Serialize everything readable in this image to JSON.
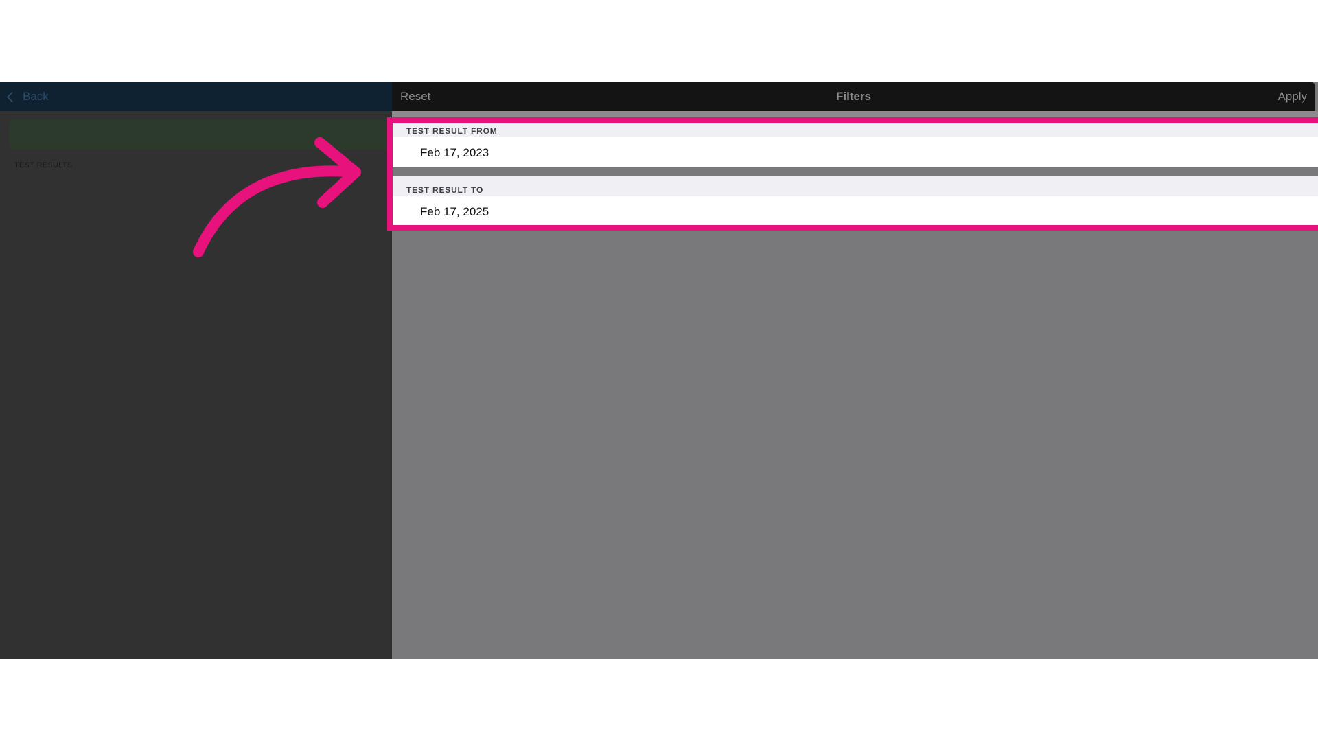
{
  "left_pane": {
    "back_label": "Back",
    "section_label": "TEST RESULTS"
  },
  "filters": {
    "reset_label": "Reset",
    "title": "Filters",
    "apply_label": "Apply",
    "from": {
      "label": "TEST RESULT FROM",
      "value": "Feb 17, 2023"
    },
    "to": {
      "label": "TEST RESULT TO",
      "value": "Feb 17, 2025"
    }
  },
  "annotation": {
    "color": "#e8127c"
  },
  "icons": {
    "back": "chevron-left-icon",
    "annotation_arrow": "curved-arrow-icon"
  }
}
